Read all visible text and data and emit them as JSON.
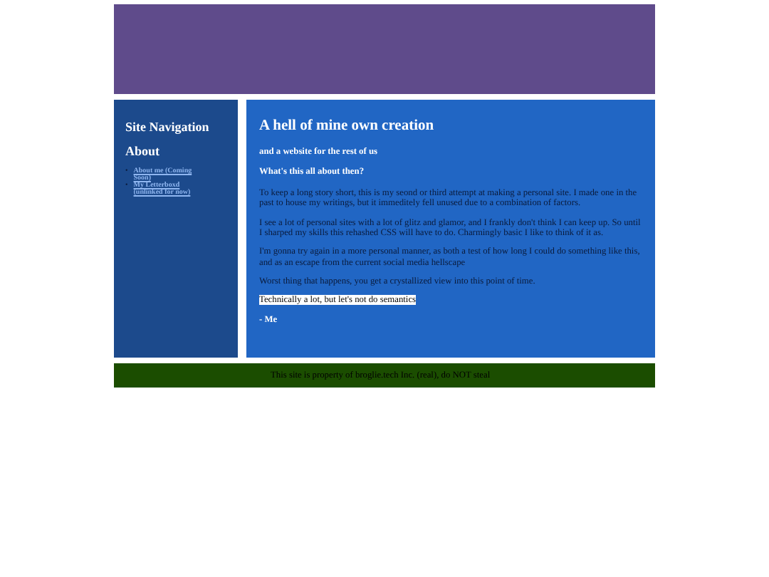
{
  "sidebar": {
    "heading": "Site Navigation",
    "subheading": "About",
    "links": [
      {
        "bullet": "•",
        "label": "About me (Coming Soon)"
      },
      {
        "bullet": "•",
        "label": "My Letterboxd (unlinked for now)"
      }
    ]
  },
  "main": {
    "title": "A hell of mine own creation",
    "subtitle": "and a website for the rest of us",
    "section_heading": "What's this all about then?",
    "paragraphs": [
      "To keep a long story short, this is my seond or third attempt at making a personal site. I made one in the past to house my writings, but it immeditely fell unused due to a combination of factors.",
      "I see a lot of personal sites with a lot of glitz and glamor, and I frankly don't think I can keep up. So until I sharped my skills this rehashed CSS will have to do. Charmingly basic I like to think of it as.",
      "I'm gonna try again in a more personal manner, as both a test of how long I could do something like this, and as an escape from the current social media hellscape",
      "Worst thing that happens, you get a crystallized view into this point of time."
    ],
    "highlight": "Technically a lot, but let's not do semantics",
    "signature": "- Me"
  },
  "footer": {
    "text": "This site is property of broglie.tech Inc. (real), do NOT steal"
  }
}
